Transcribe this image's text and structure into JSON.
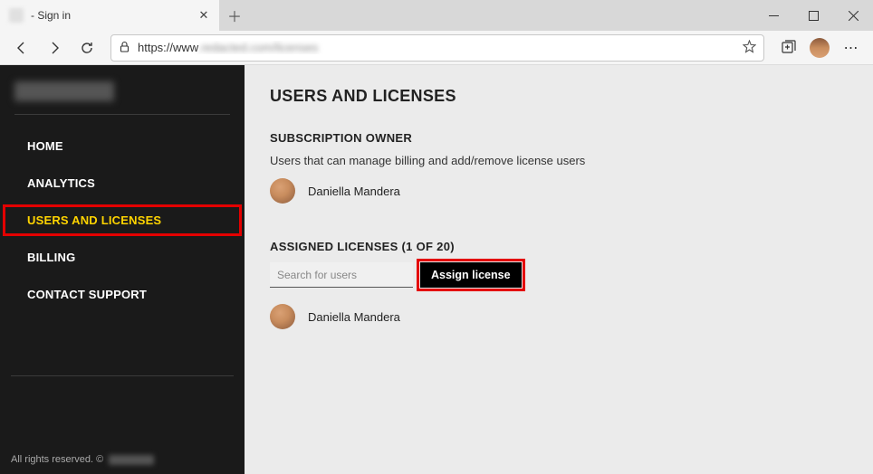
{
  "browser": {
    "tab_title": " - Sign in",
    "url_prefix": "https://www",
    "url_blur": ".redacted.com/licenses"
  },
  "sidebar": {
    "items": [
      {
        "label": "HOME"
      },
      {
        "label": "ANALYTICS"
      },
      {
        "label": "USERS AND LICENSES"
      },
      {
        "label": "BILLING"
      },
      {
        "label": "CONTACT SUPPORT"
      }
    ],
    "footer": "All rights reserved. ©"
  },
  "main": {
    "page_title": "USERS AND LICENSES",
    "owner": {
      "title": "SUBSCRIPTION OWNER",
      "desc": "Users that can manage billing and add/remove license users",
      "name": "Daniella Mandera"
    },
    "assigned": {
      "title": "ASSIGNED LICENSES (1 OF 20)",
      "search_placeholder": "Search for users",
      "assign_label": "Assign license",
      "users": [
        {
          "name": "Daniella Mandera"
        }
      ]
    }
  }
}
